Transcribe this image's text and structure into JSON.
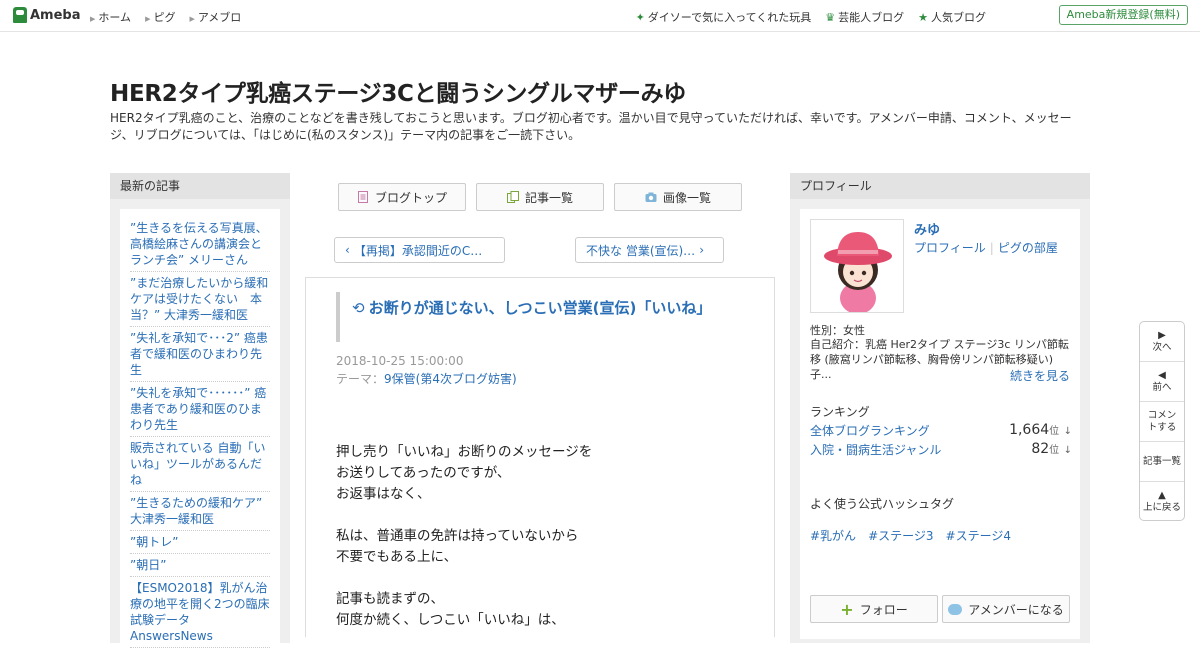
{
  "topbar": {
    "logo_text": "Ameba",
    "nav": [
      "ホーム",
      "ピグ",
      "アメブロ"
    ],
    "right_links": [
      "ダイソーで気に入ってくれた玩具",
      "芸能人ブログ",
      "人気ブログ"
    ],
    "register_label": "Ameba新規登録(無料)"
  },
  "blog": {
    "title": "HER2タイプ乳癌ステージ3Cと闘うシングルマザーみゆ",
    "description": "HER2タイプ乳癌のこと、治療のことなどを書き残しておこうと思います。ブログ初心者です。温かい目で見守っていただければ、幸いです。アメンバー申請、コメント、メッセージ、リブログについては、「はじめに(私のスタンス)」テーマ内の記事をご一読下さい。"
  },
  "left": {
    "heading": "最新の記事",
    "recent": [
      "”生きるを伝える写真展、高橋絵麻さんの講演会とランチ会” メリーさん",
      "”まだ治療したいから緩和ケアは受けたくない　本当？” 大津秀一緩和医",
      "”失礼を承知で･･･2” 癌患者で緩和医のひまわり先生",
      "”失礼を承知で･･････” 癌患者であり緩和医のひまわり先生",
      "販売されている 自動「いいね」ツールがあるんだね",
      "”生きるための緩和ケア” 大津秀一緩和医",
      "”朝トレ”",
      "”朝日”",
      "【ESMO2018】乳がん治療の地平を開く2つの臨床試験データAnswersNews"
    ]
  },
  "center": {
    "buttons": {
      "top": "ブログトップ",
      "list": "記事一覧",
      "images": "画像一覧"
    },
    "prev_label": "【再掲】承認間近のC…",
    "next_label": "不快な 営業(宣伝)…",
    "article": {
      "title": "お断りが通じない、しつこい営業(宣伝)「いいね」",
      "date": "2018-10-25 15:00:00",
      "theme_prefix": "テーマ：",
      "theme": "9保管(第4次ブログ妨害)",
      "body": [
        "押し売り「いいね」お断りのメッセージを",
        "お送りしてあったのですが、",
        "お返事はなく、",
        "",
        "私は、普通車の免許は持っていないから",
        "不要でもある上に、",
        "",
        "記事も読まずの、",
        "何度か続く、しつこい「いいね」は、"
      ]
    }
  },
  "right": {
    "heading": "プロフィール",
    "name": "みゆ",
    "link_profile": "プロフィール",
    "link_pig": "ピグの部屋",
    "gender": "性別：女性",
    "intro": "自己紹介：乳癌 Her2タイプ ステージ3c リンパ節転移 (腋窩リンパ節転移、胸骨傍リンパ節転移疑い) 子...",
    "more": "続きを見る",
    "ranking_heading": "ランキング",
    "rankings": [
      {
        "label": "全体ブログランキング",
        "value": "1,664",
        "unit": "位",
        "arrow": "↓"
      },
      {
        "label": "入院・闘病生活ジャンル",
        "value": "82",
        "unit": "位",
        "arrow": "↓"
      }
    ],
    "hashtag_heading": "よく使う公式ハッシュタグ",
    "hashtags": [
      "#乳がん",
      "#ステージ3",
      "#ステージ4"
    ],
    "follow_label": "フォロー",
    "amember_label": "アメンバーになる"
  },
  "floatnav": {
    "next": "次へ",
    "prev": "前へ",
    "comment": "コメントする",
    "list": "記事一覧",
    "top": "上に戻る"
  },
  "colors": {
    "link": "#2a6eb5",
    "brand": "#2d8c3c"
  }
}
